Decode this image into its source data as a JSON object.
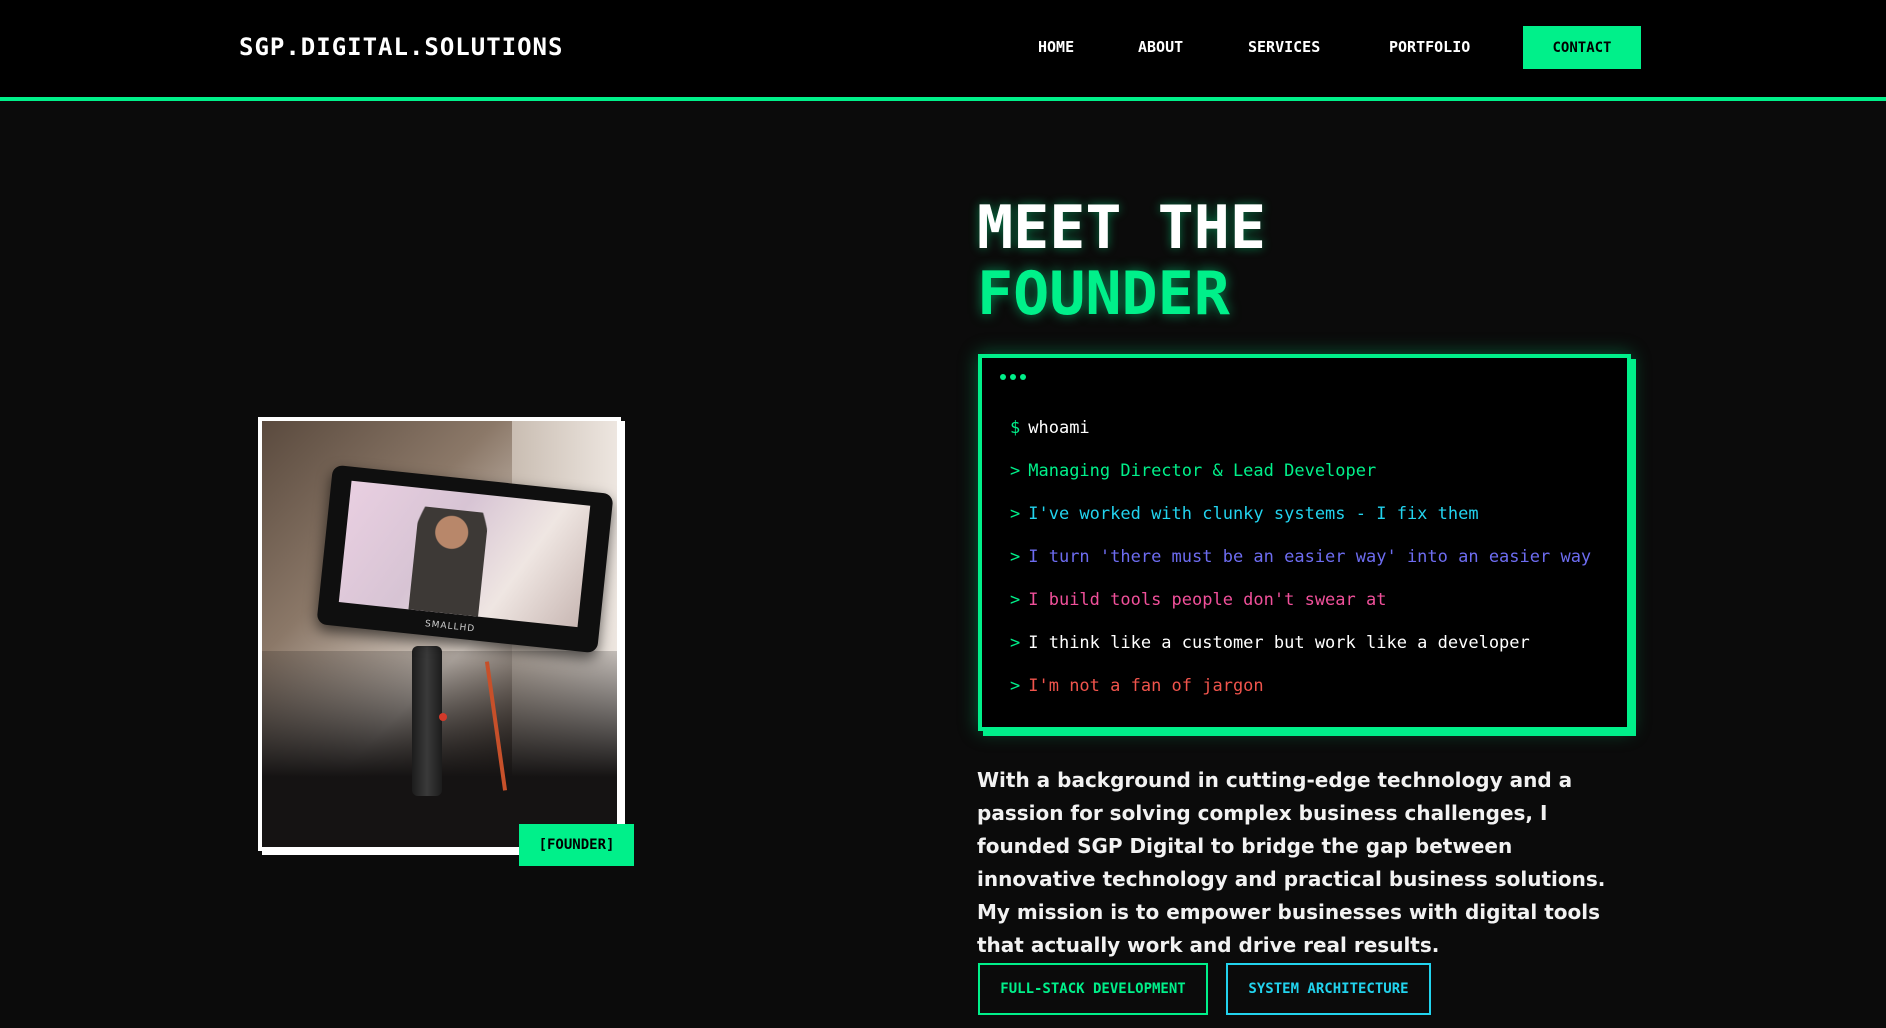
{
  "header": {
    "logo": "SGP.DIGITAL.SOLUTIONS",
    "nav": [
      "HOME",
      "ABOUT",
      "SERVICES",
      "PORTFOLIO"
    ],
    "contact_label": "CONTACT",
    "accent": "#00f08a"
  },
  "photo": {
    "tag": "[FOUNDER]",
    "monitor_brand": "SMALLHD"
  },
  "heading": {
    "line1": "MEET THE",
    "line2": "FOUNDER"
  },
  "terminal": {
    "command_prompt": "$",
    "command": "whoami",
    "output_prompt": ">",
    "lines": [
      {
        "text": "Managing Director & Lead Developer",
        "color": "#00f08a"
      },
      {
        "text": "I've worked with clunky systems - I fix them",
        "color": "#22d3ee"
      },
      {
        "text": "I turn 'there must be an easier way' into an easier way",
        "color": "#6d6cf0"
      },
      {
        "text": "I build tools people don't swear at",
        "color": "#f0509a"
      },
      {
        "text": "I think like a customer but work like a developer",
        "color": "#ffffff"
      },
      {
        "text": "I'm not a fan of jargon",
        "color": "#f0544c"
      }
    ]
  },
  "bio": "With a background in cutting-edge technology and a passion for solving complex business challenges, I founded SGP Digital to bridge the gap between innovative technology and practical business solutions. My mission is to empower businesses with digital tools that actually work and drive real results.",
  "skills": [
    "FULL-STACK DEVELOPMENT",
    "SYSTEM ARCHITECTURE"
  ]
}
